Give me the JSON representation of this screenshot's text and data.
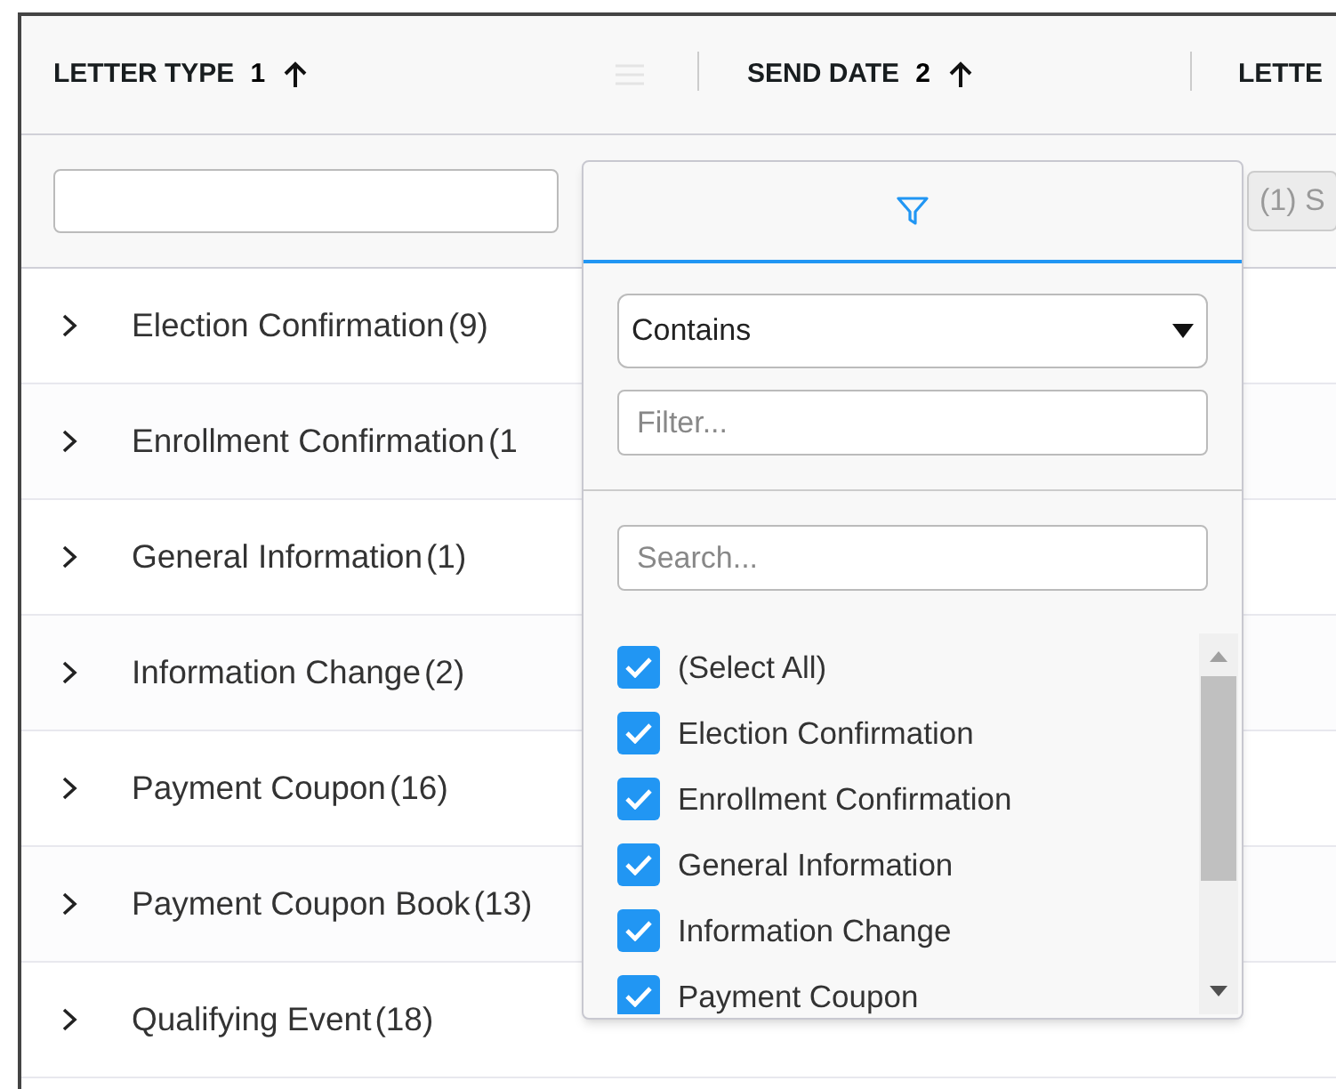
{
  "columns": [
    {
      "title": "LETTER TYPE",
      "sort_index": "1",
      "sort_ascending": true
    },
    {
      "title": "SEND DATE",
      "sort_index": "2",
      "sort_ascending": true
    },
    {
      "title": "LETTE"
    }
  ],
  "filters": {
    "column_3_value": "(1) S"
  },
  "rows": [
    {
      "name": "Election Confirmation",
      "count": "(9)",
      "expanded": false
    },
    {
      "name": "Enrollment Confirmation",
      "count": "(1",
      "expanded": false
    },
    {
      "name": "General Information",
      "count": "(1)",
      "expanded": false
    },
    {
      "name": "Information Change",
      "count": "(2)",
      "expanded": false
    },
    {
      "name": "Payment Coupon",
      "count": "(16)",
      "expanded": false
    },
    {
      "name": "Payment Coupon Book",
      "count": "(13)",
      "expanded": false
    },
    {
      "name": "Qualifying Event",
      "count": "(18)",
      "expanded": false
    }
  ],
  "filter_popup": {
    "operator": "Contains",
    "filter_placeholder": "Filter...",
    "search_placeholder": "Search...",
    "items": [
      {
        "label": "(Select All)",
        "checked": true
      },
      {
        "label": "Election Confirmation",
        "checked": true
      },
      {
        "label": "Enrollment Confirmation",
        "checked": true
      },
      {
        "label": "General Information",
        "checked": true
      },
      {
        "label": "Information Change",
        "checked": true
      },
      {
        "label": "Payment Coupon",
        "checked": true
      }
    ]
  }
}
